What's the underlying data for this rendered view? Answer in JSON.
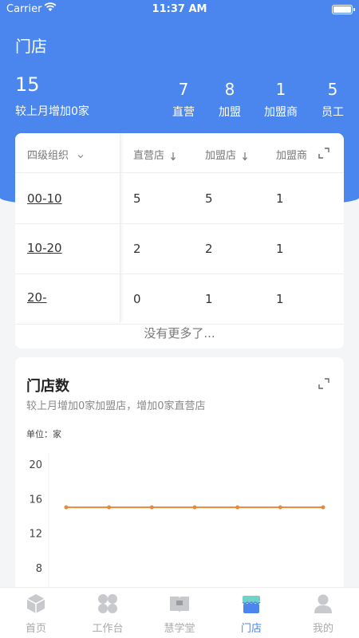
{
  "status_bar": {
    "carrier": "Carrier",
    "time": "11:37 AM"
  },
  "header": {
    "title": "门店",
    "total": "15",
    "total_sub": "较上月增加0家",
    "stats": [
      {
        "value": "7",
        "label": "直营"
      },
      {
        "value": "8",
        "label": "加盟"
      },
      {
        "value": "1",
        "label": "加盟商"
      },
      {
        "value": "5",
        "label": "员工"
      }
    ]
  },
  "table": {
    "group_label": "四级组织",
    "columns": [
      "直营店",
      "加盟店",
      "加盟商"
    ],
    "rows": [
      {
        "label": "00-10",
        "values": [
          "5",
          "5",
          "1"
        ]
      },
      {
        "label": "10-20",
        "values": [
          "2",
          "2",
          "1"
        ]
      },
      {
        "label": "20-",
        "values": [
          "0",
          "1",
          "1"
        ]
      }
    ],
    "footer": "没有更多了..."
  },
  "chart": {
    "title": "门店数",
    "subtitle": "较上月增加0家加盟店，增加0家直营店",
    "unit": "单位：家",
    "y_ticks": [
      "20",
      "16",
      "12",
      "8"
    ],
    "line_color": "#e88a3a"
  },
  "chart_data": {
    "type": "line",
    "title": "门店数",
    "ylabel": "单位：家",
    "y_ticks": [
      20,
      16,
      12,
      8
    ],
    "ylim": [
      8,
      20
    ],
    "series": [
      {
        "values": [
          15,
          15,
          15,
          15,
          15,
          15,
          15
        ]
      }
    ]
  },
  "tabbar": {
    "items": [
      {
        "label": "首页",
        "icon": "cube-icon"
      },
      {
        "label": "工作台",
        "icon": "grid-icon"
      },
      {
        "label": "慧学堂",
        "icon": "book-icon"
      },
      {
        "label": "门店",
        "icon": "store-icon"
      },
      {
        "label": "我的",
        "icon": "user-icon"
      }
    ],
    "active_index": 3,
    "active_color": "#4a86ee"
  }
}
